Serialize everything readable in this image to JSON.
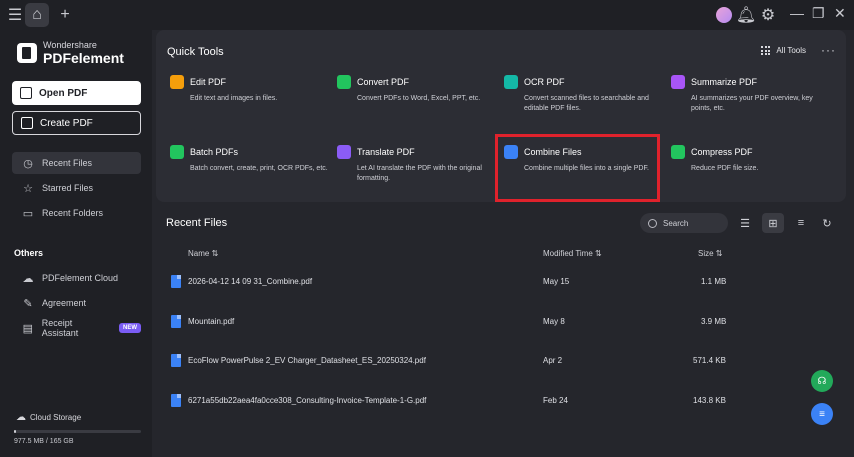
{
  "titlebar": {
    "icons": [
      "menu-icon",
      "home-icon",
      "plus-icon",
      "avatar",
      "bell-icon",
      "gear-icon",
      "minimize-icon",
      "restore-icon",
      "close-icon"
    ]
  },
  "sidebar": {
    "logo_small": "Wondershare",
    "logo_big": "PDFelement",
    "open_pdf": "Open PDF",
    "create_pdf": "Create PDF",
    "nav": [
      {
        "label": "Recent Files",
        "icon": "clock-icon"
      },
      {
        "label": "Starred Files",
        "icon": "star-icon"
      },
      {
        "label": "Recent Folders",
        "icon": "folder-icon"
      }
    ],
    "others_title": "Others",
    "others": [
      {
        "label": "PDFelement Cloud",
        "icon": "cloud-icon"
      },
      {
        "label": "Agreement",
        "icon": "handshake-icon"
      },
      {
        "label": "Receipt Assistant",
        "icon": "receipt-icon",
        "badge": "NEW"
      }
    ],
    "cloud_storage": "Cloud Storage",
    "storage_text": "977.5 MB / 165 GB",
    "storage_fraction": 0.006
  },
  "quick_tools": {
    "title": "Quick Tools",
    "all_tools": "All Tools",
    "tools": [
      {
        "name": "Edit PDF",
        "desc": "Edit text and images in files.",
        "color": "#f59e0b"
      },
      {
        "name": "Convert PDF",
        "desc": "Convert PDFs to Word, Excel, PPT, etc.",
        "color": "#22c55e"
      },
      {
        "name": "OCR PDF",
        "desc": "Convert scanned files to searchable and editable PDF files.",
        "color": "#14b8a6"
      },
      {
        "name": "Summarize PDF",
        "desc": "AI summarizes your PDF overview, key points, etc.",
        "color": "#a855f7"
      },
      {
        "name": "Batch PDFs",
        "desc": "Batch convert, create, print, OCR PDFs, etc.",
        "color": "#22c55e"
      },
      {
        "name": "Translate PDF",
        "desc": "Let AI translate the PDF with the original formatting.",
        "color": "#8b5cf6"
      },
      {
        "name": "Combine Files",
        "desc": "Combine multiple files into a single PDF.",
        "color": "#3b82f6"
      },
      {
        "name": "Compress PDF",
        "desc": "Reduce PDF file size.",
        "color": "#22c55e"
      }
    ]
  },
  "recent": {
    "title": "Recent Files",
    "search_placeholder": "Search",
    "columns": {
      "name": "Name",
      "modified": "Modified Time",
      "size": "Size"
    },
    "files": [
      {
        "name": "2026-04-12 14 09 31_Combine.pdf",
        "modified": "May 15",
        "size": "1.1 MB"
      },
      {
        "name": "Mountain.pdf",
        "modified": "May 8",
        "size": "3.9 MB"
      },
      {
        "name": "EcoFlow PowerPulse 2_EV Charger_Datasheet_ES_20250324.pdf",
        "modified": "Apr 2",
        "size": "571.4 KB"
      },
      {
        "name": "6271a55db22aea4fa0cce308_Consulting-Invoice-Template-1-G.pdf",
        "modified": "Feb 24",
        "size": "143.8 KB"
      }
    ]
  },
  "colors": {
    "highlight": "#e0222c",
    "support_fab": "#22a95a",
    "menu_fab": "#3b82f6",
    "badge": "#7a5cf5"
  }
}
